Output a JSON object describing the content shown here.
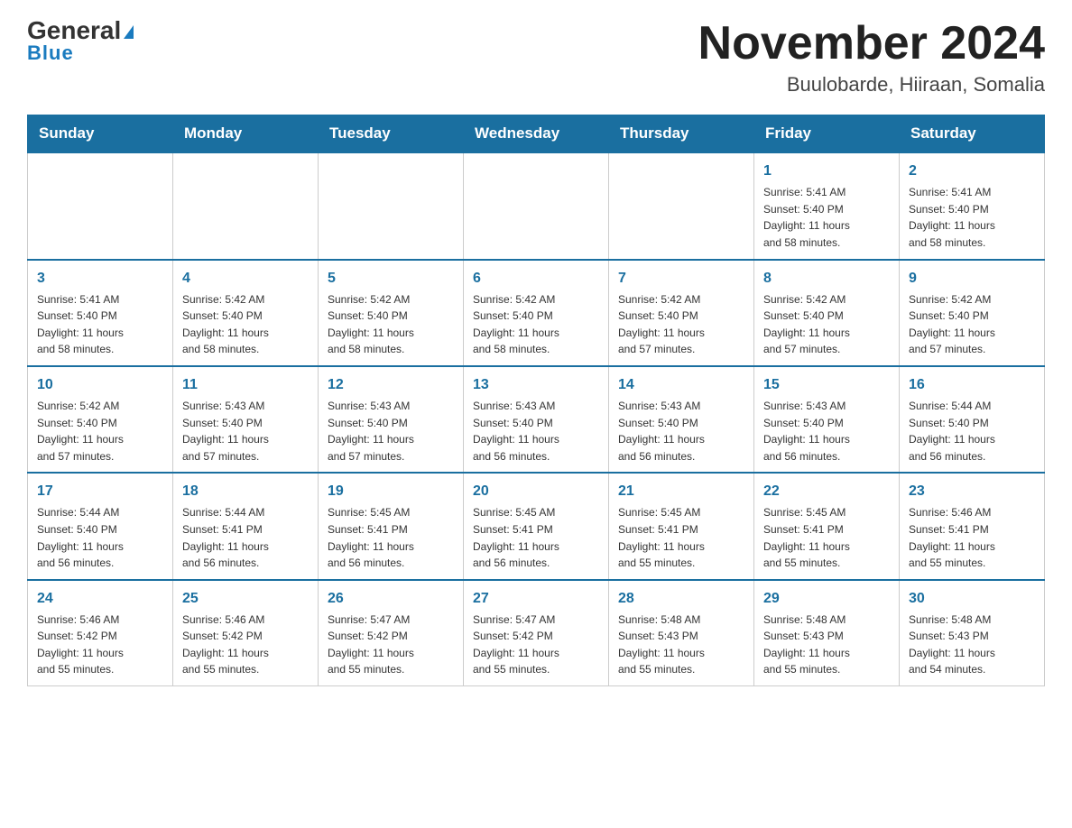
{
  "header": {
    "logo_general": "General",
    "logo_blue": "Blue",
    "month_title": "November 2024",
    "location": "Buulobarde, Hiiraan, Somalia"
  },
  "days_of_week": [
    "Sunday",
    "Monday",
    "Tuesday",
    "Wednesday",
    "Thursday",
    "Friday",
    "Saturday"
  ],
  "weeks": [
    {
      "days": [
        {
          "number": "",
          "info": ""
        },
        {
          "number": "",
          "info": ""
        },
        {
          "number": "",
          "info": ""
        },
        {
          "number": "",
          "info": ""
        },
        {
          "number": "",
          "info": ""
        },
        {
          "number": "1",
          "info": "Sunrise: 5:41 AM\nSunset: 5:40 PM\nDaylight: 11 hours\nand 58 minutes."
        },
        {
          "number": "2",
          "info": "Sunrise: 5:41 AM\nSunset: 5:40 PM\nDaylight: 11 hours\nand 58 minutes."
        }
      ]
    },
    {
      "days": [
        {
          "number": "3",
          "info": "Sunrise: 5:41 AM\nSunset: 5:40 PM\nDaylight: 11 hours\nand 58 minutes."
        },
        {
          "number": "4",
          "info": "Sunrise: 5:42 AM\nSunset: 5:40 PM\nDaylight: 11 hours\nand 58 minutes."
        },
        {
          "number": "5",
          "info": "Sunrise: 5:42 AM\nSunset: 5:40 PM\nDaylight: 11 hours\nand 58 minutes."
        },
        {
          "number": "6",
          "info": "Sunrise: 5:42 AM\nSunset: 5:40 PM\nDaylight: 11 hours\nand 58 minutes."
        },
        {
          "number": "7",
          "info": "Sunrise: 5:42 AM\nSunset: 5:40 PM\nDaylight: 11 hours\nand 57 minutes."
        },
        {
          "number": "8",
          "info": "Sunrise: 5:42 AM\nSunset: 5:40 PM\nDaylight: 11 hours\nand 57 minutes."
        },
        {
          "number": "9",
          "info": "Sunrise: 5:42 AM\nSunset: 5:40 PM\nDaylight: 11 hours\nand 57 minutes."
        }
      ]
    },
    {
      "days": [
        {
          "number": "10",
          "info": "Sunrise: 5:42 AM\nSunset: 5:40 PM\nDaylight: 11 hours\nand 57 minutes."
        },
        {
          "number": "11",
          "info": "Sunrise: 5:43 AM\nSunset: 5:40 PM\nDaylight: 11 hours\nand 57 minutes."
        },
        {
          "number": "12",
          "info": "Sunrise: 5:43 AM\nSunset: 5:40 PM\nDaylight: 11 hours\nand 57 minutes."
        },
        {
          "number": "13",
          "info": "Sunrise: 5:43 AM\nSunset: 5:40 PM\nDaylight: 11 hours\nand 56 minutes."
        },
        {
          "number": "14",
          "info": "Sunrise: 5:43 AM\nSunset: 5:40 PM\nDaylight: 11 hours\nand 56 minutes."
        },
        {
          "number": "15",
          "info": "Sunrise: 5:43 AM\nSunset: 5:40 PM\nDaylight: 11 hours\nand 56 minutes."
        },
        {
          "number": "16",
          "info": "Sunrise: 5:44 AM\nSunset: 5:40 PM\nDaylight: 11 hours\nand 56 minutes."
        }
      ]
    },
    {
      "days": [
        {
          "number": "17",
          "info": "Sunrise: 5:44 AM\nSunset: 5:40 PM\nDaylight: 11 hours\nand 56 minutes."
        },
        {
          "number": "18",
          "info": "Sunrise: 5:44 AM\nSunset: 5:41 PM\nDaylight: 11 hours\nand 56 minutes."
        },
        {
          "number": "19",
          "info": "Sunrise: 5:45 AM\nSunset: 5:41 PM\nDaylight: 11 hours\nand 56 minutes."
        },
        {
          "number": "20",
          "info": "Sunrise: 5:45 AM\nSunset: 5:41 PM\nDaylight: 11 hours\nand 56 minutes."
        },
        {
          "number": "21",
          "info": "Sunrise: 5:45 AM\nSunset: 5:41 PM\nDaylight: 11 hours\nand 55 minutes."
        },
        {
          "number": "22",
          "info": "Sunrise: 5:45 AM\nSunset: 5:41 PM\nDaylight: 11 hours\nand 55 minutes."
        },
        {
          "number": "23",
          "info": "Sunrise: 5:46 AM\nSunset: 5:41 PM\nDaylight: 11 hours\nand 55 minutes."
        }
      ]
    },
    {
      "days": [
        {
          "number": "24",
          "info": "Sunrise: 5:46 AM\nSunset: 5:42 PM\nDaylight: 11 hours\nand 55 minutes."
        },
        {
          "number": "25",
          "info": "Sunrise: 5:46 AM\nSunset: 5:42 PM\nDaylight: 11 hours\nand 55 minutes."
        },
        {
          "number": "26",
          "info": "Sunrise: 5:47 AM\nSunset: 5:42 PM\nDaylight: 11 hours\nand 55 minutes."
        },
        {
          "number": "27",
          "info": "Sunrise: 5:47 AM\nSunset: 5:42 PM\nDaylight: 11 hours\nand 55 minutes."
        },
        {
          "number": "28",
          "info": "Sunrise: 5:48 AM\nSunset: 5:43 PM\nDaylight: 11 hours\nand 55 minutes."
        },
        {
          "number": "29",
          "info": "Sunrise: 5:48 AM\nSunset: 5:43 PM\nDaylight: 11 hours\nand 55 minutes."
        },
        {
          "number": "30",
          "info": "Sunrise: 5:48 AM\nSunset: 5:43 PM\nDaylight: 11 hours\nand 54 minutes."
        }
      ]
    }
  ]
}
